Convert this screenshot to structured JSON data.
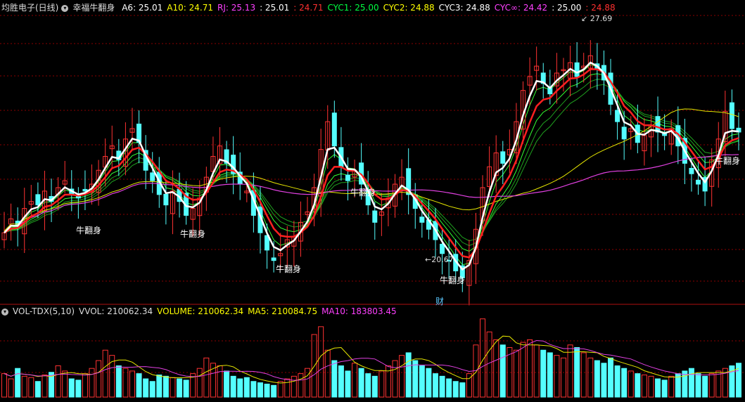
{
  "header": {
    "stock_title": "均胜电子(日线)",
    "indicator_name": "幸福牛翻身",
    "items": [
      {
        "text": "A6: 25.01",
        "color": "#ffffff"
      },
      {
        "text": "A10: 24.71",
        "color": "#ffff00"
      },
      {
        "text": "RJ: 25.13",
        "color": "#ff40ff"
      },
      {
        "text": ": 25.01",
        "color": "#ffffff"
      },
      {
        "text": ": 24.71",
        "color": "#ff3030"
      },
      {
        "text": "CYC1: 25.00",
        "color": "#00ff40"
      },
      {
        "text": "CYC2: 24.88",
        "color": "#ffff00"
      },
      {
        "text": "CYC3: 24.88",
        "color": "#ffffff"
      },
      {
        "text": "CYC∞: 24.42",
        "color": "#ff40ff"
      },
      {
        "text": ": 25.00",
        "color": "#ffffff"
      },
      {
        "text": ": 24.88",
        "color": "#ff3030"
      }
    ]
  },
  "volume_header": {
    "items": [
      {
        "text": "VOL-TDX(5,10)",
        "color": "#dddddd"
      },
      {
        "text": "VVOL: 210062.34",
        "color": "#dddddd"
      },
      {
        "text": "VOLUME: 210062.34",
        "color": "#ffff00"
      },
      {
        "text": "MA5: 210084.75",
        "color": "#ffff00"
      },
      {
        "text": "MA10: 183803.45",
        "color": "#ff40ff"
      }
    ]
  },
  "annotations": {
    "high": "27.69",
    "low": "20.67",
    "cai": "财"
  },
  "signal_label": "牛翻身",
  "colors": {
    "up": "#ff3232",
    "down": "#54ffff",
    "grid": "#8b0000",
    "background": "#000000"
  },
  "chart_data": [
    {
      "type": "candlestick",
      "title": "幸福牛翻身",
      "price_high_marker": 27.69,
      "price_low_marker": 20.67,
      "ylim": [
        20.2,
        28.4
      ],
      "signals_count": 7,
      "series": [
        {
          "name": "A6",
          "last": 25.01
        },
        {
          "name": "A10",
          "last": 24.71
        },
        {
          "name": "RJ",
          "last": 25.13
        },
        {
          "name": "CYC1",
          "last": 25.0
        },
        {
          "name": "CYC2",
          "last": 24.88
        },
        {
          "name": "CYC3",
          "last": 24.88
        },
        {
          "name": "CYC∞",
          "last": 24.42
        }
      ],
      "closes": [
        22.1,
        22.5,
        22.3,
        22.8,
        23.0,
        22.9,
        23.3,
        23.0,
        23.4,
        23.6,
        23.2,
        23.1,
        23.3,
        23.5,
        23.9,
        24.3,
        24.6,
        24.2,
        24.8,
        25.1,
        24.7,
        23.9,
        23.6,
        23.2,
        22.9,
        23.3,
        23.0,
        22.6,
        22.8,
        23.1,
        23.7,
        24.3,
        24.6,
        24.1,
        23.8,
        23.5,
        23.3,
        22.6,
        22.1,
        21.6,
        21.3,
        21.5,
        21.9,
        22.0,
        22.4,
        22.7,
        23.4,
        24.5,
        25.3,
        24.6,
        24.0,
        23.6,
        23.9,
        23.5,
        22.9,
        22.4,
        22.7,
        23.1,
        23.5,
        23.7,
        23.2,
        22.8,
        22.4,
        22.2,
        21.9,
        21.5,
        21.3,
        21.0,
        20.8,
        21.3,
        22.2,
        23.4,
        24.0,
        24.4,
        24.1,
        24.5,
        25.3,
        26.2,
        26.6,
        26.9,
        26.4,
        26.1,
        26.7,
        26.8,
        27.0,
        26.6,
        26.9,
        27.2,
        26.8,
        26.5,
        25.8,
        25.3,
        24.8,
        25.1,
        24.7,
        24.9,
        25.2,
        25.0,
        24.9,
        25.1,
        24.6,
        24.1,
        23.8,
        23.5,
        23.3,
        24.2,
        24.8,
        25.6,
        25.1,
        25.0
      ]
    },
    {
      "type": "bar",
      "title": "VOL-TDX(5,10)",
      "series": [
        {
          "name": "VOLUME",
          "last": 210062.34
        },
        {
          "name": "MA5",
          "last": 210084.75
        },
        {
          "name": "MA10",
          "last": 183803.45
        }
      ],
      "values": [
        90,
        70,
        110,
        80,
        75,
        60,
        85,
        95,
        120,
        100,
        70,
        65,
        90,
        110,
        140,
        180,
        160,
        120,
        110,
        100,
        90,
        70,
        60,
        85,
        80,
        75,
        70,
        65,
        90,
        110,
        150,
        130,
        120,
        100,
        80,
        70,
        75,
        60,
        55,
        50,
        45,
        60,
        70,
        80,
        90,
        110,
        240,
        270,
        180,
        140,
        120,
        100,
        130,
        110,
        90,
        80,
        100,
        120,
        140,
        160,
        170,
        140,
        120,
        110,
        90,
        80,
        70,
        60,
        55,
        90,
        200,
        300,
        250,
        220,
        200,
        190,
        180,
        210,
        220,
        200,
        180,
        170,
        160,
        150,
        200,
        190,
        170,
        150,
        140,
        130,
        150,
        120,
        110,
        100,
        90,
        85,
        80,
        70,
        65,
        80,
        90,
        100,
        110,
        90,
        80,
        90,
        100,
        110,
        120,
        130
      ]
    }
  ]
}
